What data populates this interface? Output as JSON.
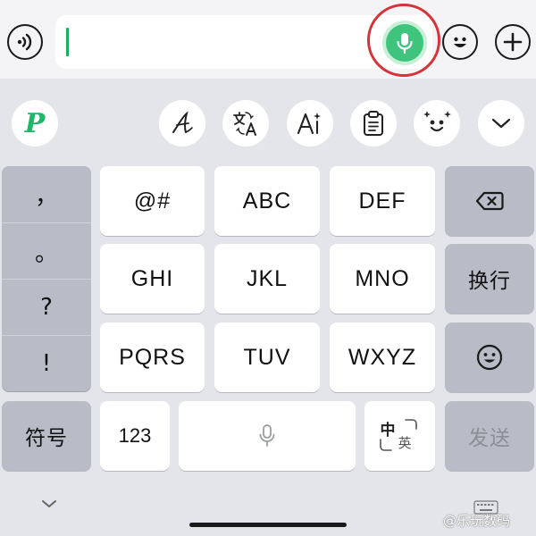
{
  "input_bar": {
    "text_value": "",
    "icons": {
      "voice_toggle": "voice-wave-icon",
      "mic": "microphone-icon",
      "emoji": "smiley-icon",
      "plus": "plus-icon"
    },
    "colors": {
      "mic_green": "#3ec47c",
      "highlight_ring": "#d7323a",
      "caret": "#16b25f"
    }
  },
  "toolbar": {
    "logo_text": "P",
    "tools": [
      "handwriting-icon",
      "translate-icon",
      "ai-text-icon",
      "clipboard-icon",
      "face-sticker-icon",
      "chevron-down-icon"
    ]
  },
  "keyboard": {
    "punctuation": [
      "，",
      "。",
      "?",
      "!"
    ],
    "rows": [
      [
        "@#",
        "ABC",
        "DEF"
      ],
      [
        "GHI",
        "JKL",
        "MNO"
      ],
      [
        "PQRS",
        "TUV",
        "WXYZ"
      ]
    ],
    "backspace_icon": "backspace-icon",
    "enter_label": "换行",
    "emoji_icon": "smiley-icon",
    "symbols_label": "符号",
    "numbers_label": "123",
    "space_icon": "microphone-icon",
    "lang_cn": "中",
    "lang_en": "英",
    "send_label": "发送"
  },
  "bottom": {
    "collapse_icon": "chevron-down-icon",
    "keyboard_switch_icon": "keyboard-icon",
    "watermark": "@乐玩数码"
  }
}
